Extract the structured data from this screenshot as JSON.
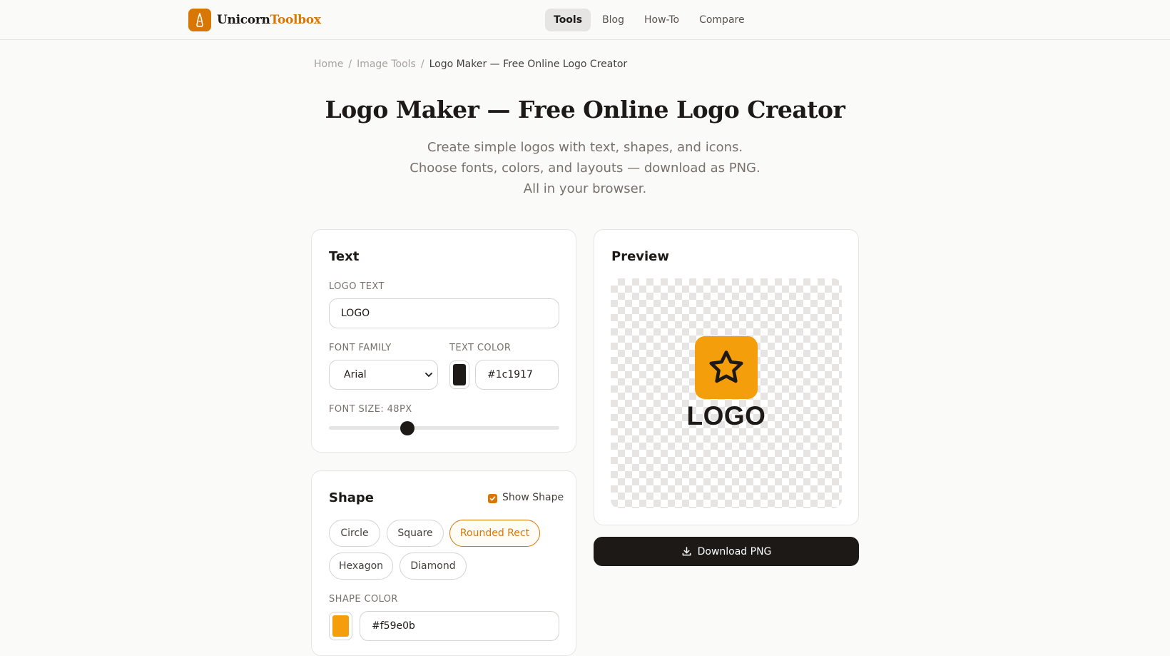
{
  "brand": {
    "name_main": "Unicorn",
    "name_accent": "Toolbox"
  },
  "nav": [
    {
      "label": "Tools",
      "active": true
    },
    {
      "label": "Blog",
      "active": false
    },
    {
      "label": "How-To",
      "active": false
    },
    {
      "label": "Compare",
      "active": false
    }
  ],
  "breadcrumb": {
    "home": "Home",
    "section": "Image Tools",
    "current": "Logo Maker — Free Online Logo Creator",
    "separator": "/"
  },
  "page": {
    "title": "Logo Maker — Free Online Logo Creator",
    "description": "Create simple logos with text, shapes, and icons. Choose fonts, colors, and layouts — download as PNG. All in your browser."
  },
  "text_panel": {
    "title": "Text",
    "logo_text_label": "LOGO TEXT",
    "logo_text_value": "LOGO",
    "font_family_label": "FONT FAMILY",
    "font_family_value": "Arial",
    "text_color_label": "TEXT COLOR",
    "text_color_value": "#1c1917",
    "font_size_label": "FONT SIZE: 48PX",
    "font_size_fraction": 0.34
  },
  "shape_panel": {
    "title": "Shape",
    "show_shape_label": "Show Shape",
    "show_shape_checked": true,
    "shapes": [
      {
        "label": "Circle",
        "active": false
      },
      {
        "label": "Square",
        "active": false
      },
      {
        "label": "Rounded Rect",
        "active": true
      },
      {
        "label": "Hexagon",
        "active": false
      },
      {
        "label": "Diamond",
        "active": false
      }
    ],
    "shape_color_label": "SHAPE COLOR",
    "shape_color_value": "#f59e0b"
  },
  "preview": {
    "title": "Preview",
    "logo_text": "LOGO",
    "icon": "star-icon"
  },
  "download": {
    "label": "Download PNG"
  },
  "colors": {
    "accent": "#d97706",
    "dark": "#1c1917",
    "shape": "#f59e0b",
    "text": "#1c1917"
  }
}
